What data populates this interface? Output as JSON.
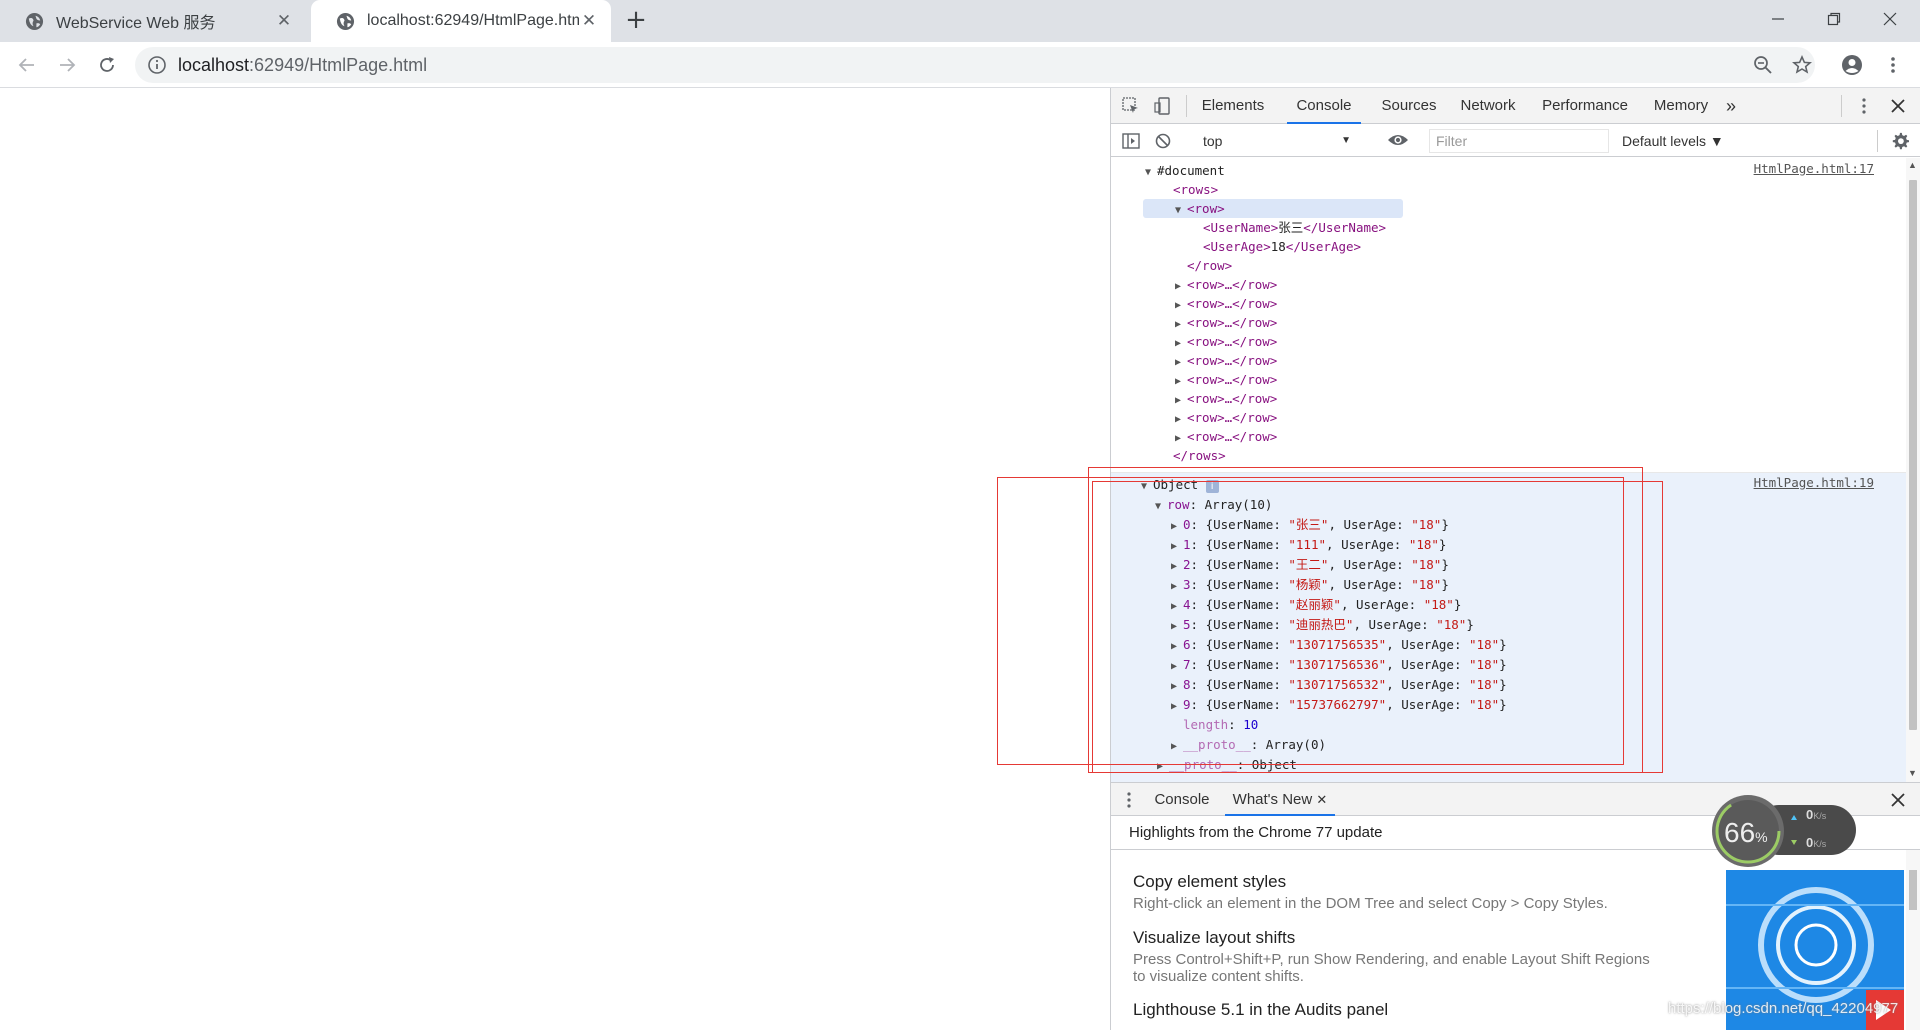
{
  "browser": {
    "tabs": [
      {
        "title": "WebService Web 服务",
        "active": false
      },
      {
        "title": "localhost:62949/HtmlPage.html",
        "active": true
      }
    ],
    "new_tab_label": "+",
    "url_host": "localhost",
    "url_rest": ":62949/HtmlPage.html"
  },
  "devtools": {
    "panels": [
      "Elements",
      "Console",
      "Sources",
      "Network",
      "Performance",
      "Memory"
    ],
    "more_panels": "»",
    "context": "top",
    "filter_placeholder": "Filter",
    "levels": "Default levels ▼",
    "messages": {
      "xml": {
        "source": "HtmlPage.html:17",
        "document": "#document",
        "rows_open": "<rows>",
        "row_open": "<row>",
        "username_line": "张三",
        "userage_line": "18",
        "row_close": "</row>",
        "collapsed_row": "<row>…</row>",
        "rows_close": "</rows>"
      },
      "object": {
        "source": "HtmlPage.html:19",
        "label": "Object",
        "info_icon": "i",
        "row_key": "row",
        "row_value": "Array(10)",
        "items": [
          {
            "index": "0",
            "UserName": "张三",
            "UserAge": "18"
          },
          {
            "index": "1",
            "UserName": "111",
            "UserAge": "18"
          },
          {
            "index": "2",
            "UserName": "王二",
            "UserAge": "18"
          },
          {
            "index": "3",
            "UserName": "杨颖",
            "UserAge": "18"
          },
          {
            "index": "4",
            "UserName": "赵丽颖",
            "UserAge": "18"
          },
          {
            "index": "5",
            "UserName": "迪丽热巴",
            "UserAge": "18"
          },
          {
            "index": "6",
            "UserName": "13071756535",
            "UserAge": "18"
          },
          {
            "index": "7",
            "UserName": "13071756536",
            "UserAge": "18"
          },
          {
            "index": "8",
            "UserName": "13071756532",
            "UserAge": "18"
          },
          {
            "index": "9",
            "UserName": "15737662797",
            "UserAge": "18"
          }
        ],
        "length_key": "length",
        "length_value": "10",
        "proto_key": "__proto__",
        "proto_array": "Array(0)",
        "proto_object": "Object"
      }
    },
    "drawer": {
      "tabs": [
        "Console",
        "What's New"
      ],
      "header": "Highlights from the Chrome 77 update",
      "items": [
        {
          "title": "Copy element styles",
          "desc": "Right-click an element in the DOM Tree and select Copy > Copy Styles."
        },
        {
          "title": "Visualize layout shifts",
          "desc": "Press Control+Shift+P, run Show Rendering, and enable Layout Shift Regions to visualize content shifts."
        },
        {
          "title": "Lighthouse 5.1 in the Audits panel",
          "desc": ""
        }
      ]
    }
  },
  "net_widget": {
    "percent": "66",
    "percent_sign": "%",
    "up": "0",
    "down": "0",
    "unit": "K/s"
  },
  "watermark": "https://blog.csdn.net/qq_42204977"
}
